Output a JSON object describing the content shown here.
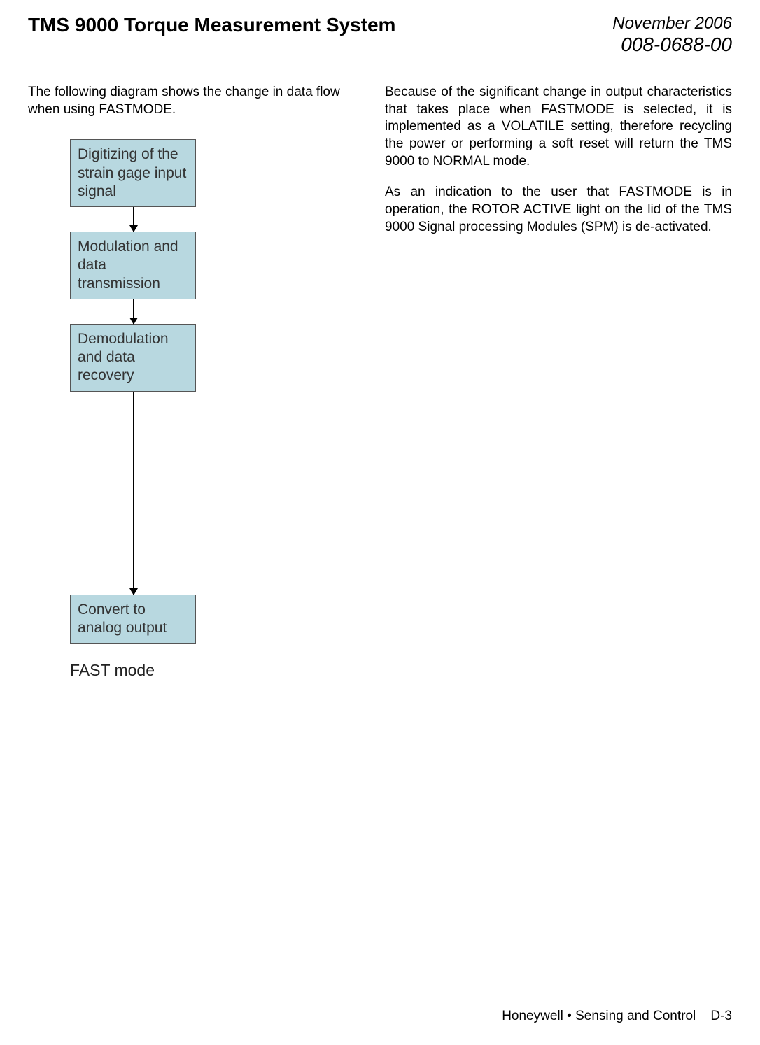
{
  "header": {
    "title": "TMS 9000 Torque Measurement System",
    "date": "November 2006",
    "doc_number": "008-0688-00"
  },
  "left_column": {
    "intro": "The following diagram shows the change in data flow when using FASTMODE.",
    "diagram": {
      "box1": "Digitizing of the strain gage input signal",
      "box2": "Modulation and data transmission",
      "box3": "Demodulation and data recovery",
      "box4": "Convert to analog output",
      "caption": "FAST mode"
    }
  },
  "right_column": {
    "para1": "Because of the significant change in output characteristics that takes place when FASTMODE is selected, it is implemented as a VOLATILE setting, therefore recycling the power or performing a soft reset will return the TMS 9000 to NORMAL mode.",
    "para2": "As an indication to the user that FASTMODE is in operation, the ROTOR ACTIVE light on the lid of the TMS 9000 Signal processing Modules (SPM) is de-activated."
  },
  "footer": {
    "company": "Honeywell",
    "bullet": "•",
    "division": "Sensing and Control",
    "page": "D-3"
  }
}
